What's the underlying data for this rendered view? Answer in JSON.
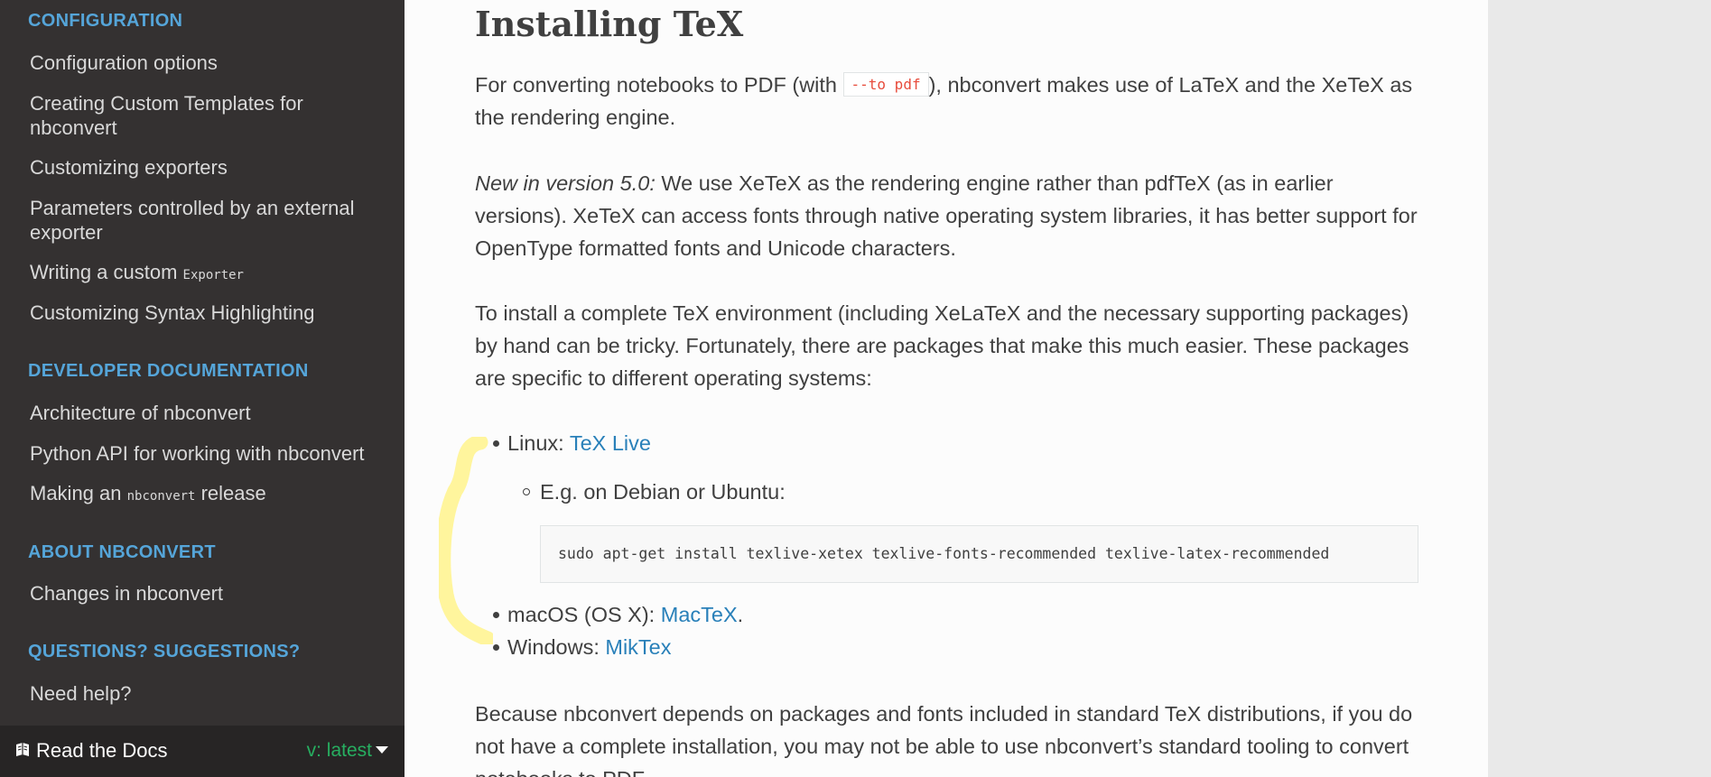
{
  "sidebar": {
    "sections": [
      {
        "title": "CONFIGURATION"
      },
      {
        "title": "DEVELOPER DOCUMENTATION"
      },
      {
        "title": "ABOUT NBCONVERT"
      },
      {
        "title": "QUESTIONS? SUGGESTIONS?"
      }
    ],
    "config_items": [
      "Configuration options",
      "Creating Custom Templates for nbconvert",
      "Customizing exporters",
      "Parameters controlled by an external exporter",
      "Writing a custom ",
      "Customizing Syntax Highlighting"
    ],
    "exporter_code": "Exporter",
    "dev_items": [
      "Architecture of nbconvert",
      "Python API for working with nbconvert",
      "Making an "
    ],
    "release_code": "nbconvert",
    "release_suffix": " release",
    "about_items": [
      "Changes in nbconvert"
    ],
    "questions_items": [
      "Need help?"
    ]
  },
  "rtd": {
    "label": "Read the Docs",
    "version": "v: latest",
    "icon": "book-icon"
  },
  "main": {
    "title": "Installing TeX",
    "p1_before": "For converting notebooks to PDF (with ",
    "p1_code": "--to pdf",
    "p1_after": "), nbconvert makes use of LaTeX and the XeTeX as the rendering engine.",
    "p2_em": "New in version 5.0:",
    "p2_rest": " We use XeTeX as the rendering engine rather than pdfTeX (as in earlier versions). XeTeX can access fonts through native operating system libraries, it has better support for OpenType formatted fonts and Unicode characters.",
    "p3": "To install a complete TeX environment (including XeLaTeX and the necessary supporting packages) by hand can be tricky. Fortunately, there are packages that make this much easier. These packages are specific to different operating systems:",
    "linux_label": "Linux: ",
    "linux_link": "TeX Live",
    "debian_label": "E.g. on Debian or Ubuntu:",
    "debian_code": "sudo apt-get install texlive-xetex texlive-fonts-recommended texlive-latex-recommended",
    "mac_label": "macOS (OS X): ",
    "mac_link": "MacTeX",
    "mac_suffix": ".",
    "win_label": "Windows: ",
    "win_link": "MikTex",
    "p4": "Because nbconvert depends on packages and fonts included in standard TeX distributions, if you do not have a complete installation, you may not be able to use nbconvert’s standard tooling to convert notebooks to PDF."
  },
  "colors": {
    "sidebar_bg": "#343131",
    "section_heading": "#55a5d9",
    "link": "#2980b9",
    "version_green": "#27ae60",
    "highlight": "#fff59d"
  }
}
